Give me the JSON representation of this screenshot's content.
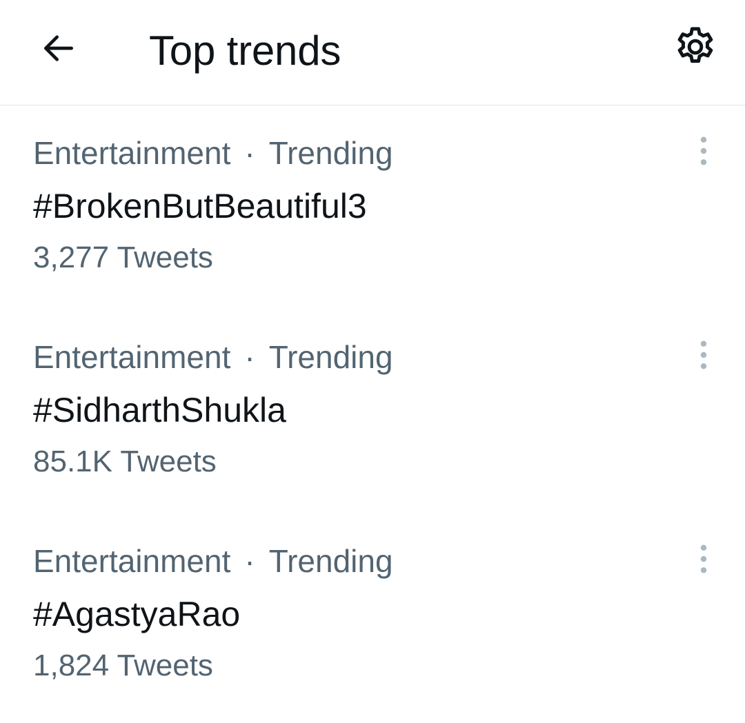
{
  "header": {
    "title": "Top trends",
    "back_icon": "arrow-left-icon",
    "settings_icon": "gear-icon"
  },
  "colors": {
    "primary_text": "#0f1419",
    "secondary_text": "#536471",
    "divider": "#e1e5e8",
    "more_icon": "#aab8c2"
  },
  "trends": [
    {
      "category": "Entertainment",
      "separator": "·",
      "status": "Trending",
      "name": "#BrokenButBeautiful3",
      "count": "3,277 Tweets",
      "more_icon": "more-vertical-icon"
    },
    {
      "category": "Entertainment",
      "separator": "·",
      "status": "Trending",
      "name": "#SidharthShukla",
      "count": "85.1K Tweets",
      "more_icon": "more-vertical-icon"
    },
    {
      "category": "Entertainment",
      "separator": "·",
      "status": "Trending",
      "name": "#AgastyaRao",
      "count": "1,824 Tweets",
      "more_icon": "more-vertical-icon"
    }
  ]
}
